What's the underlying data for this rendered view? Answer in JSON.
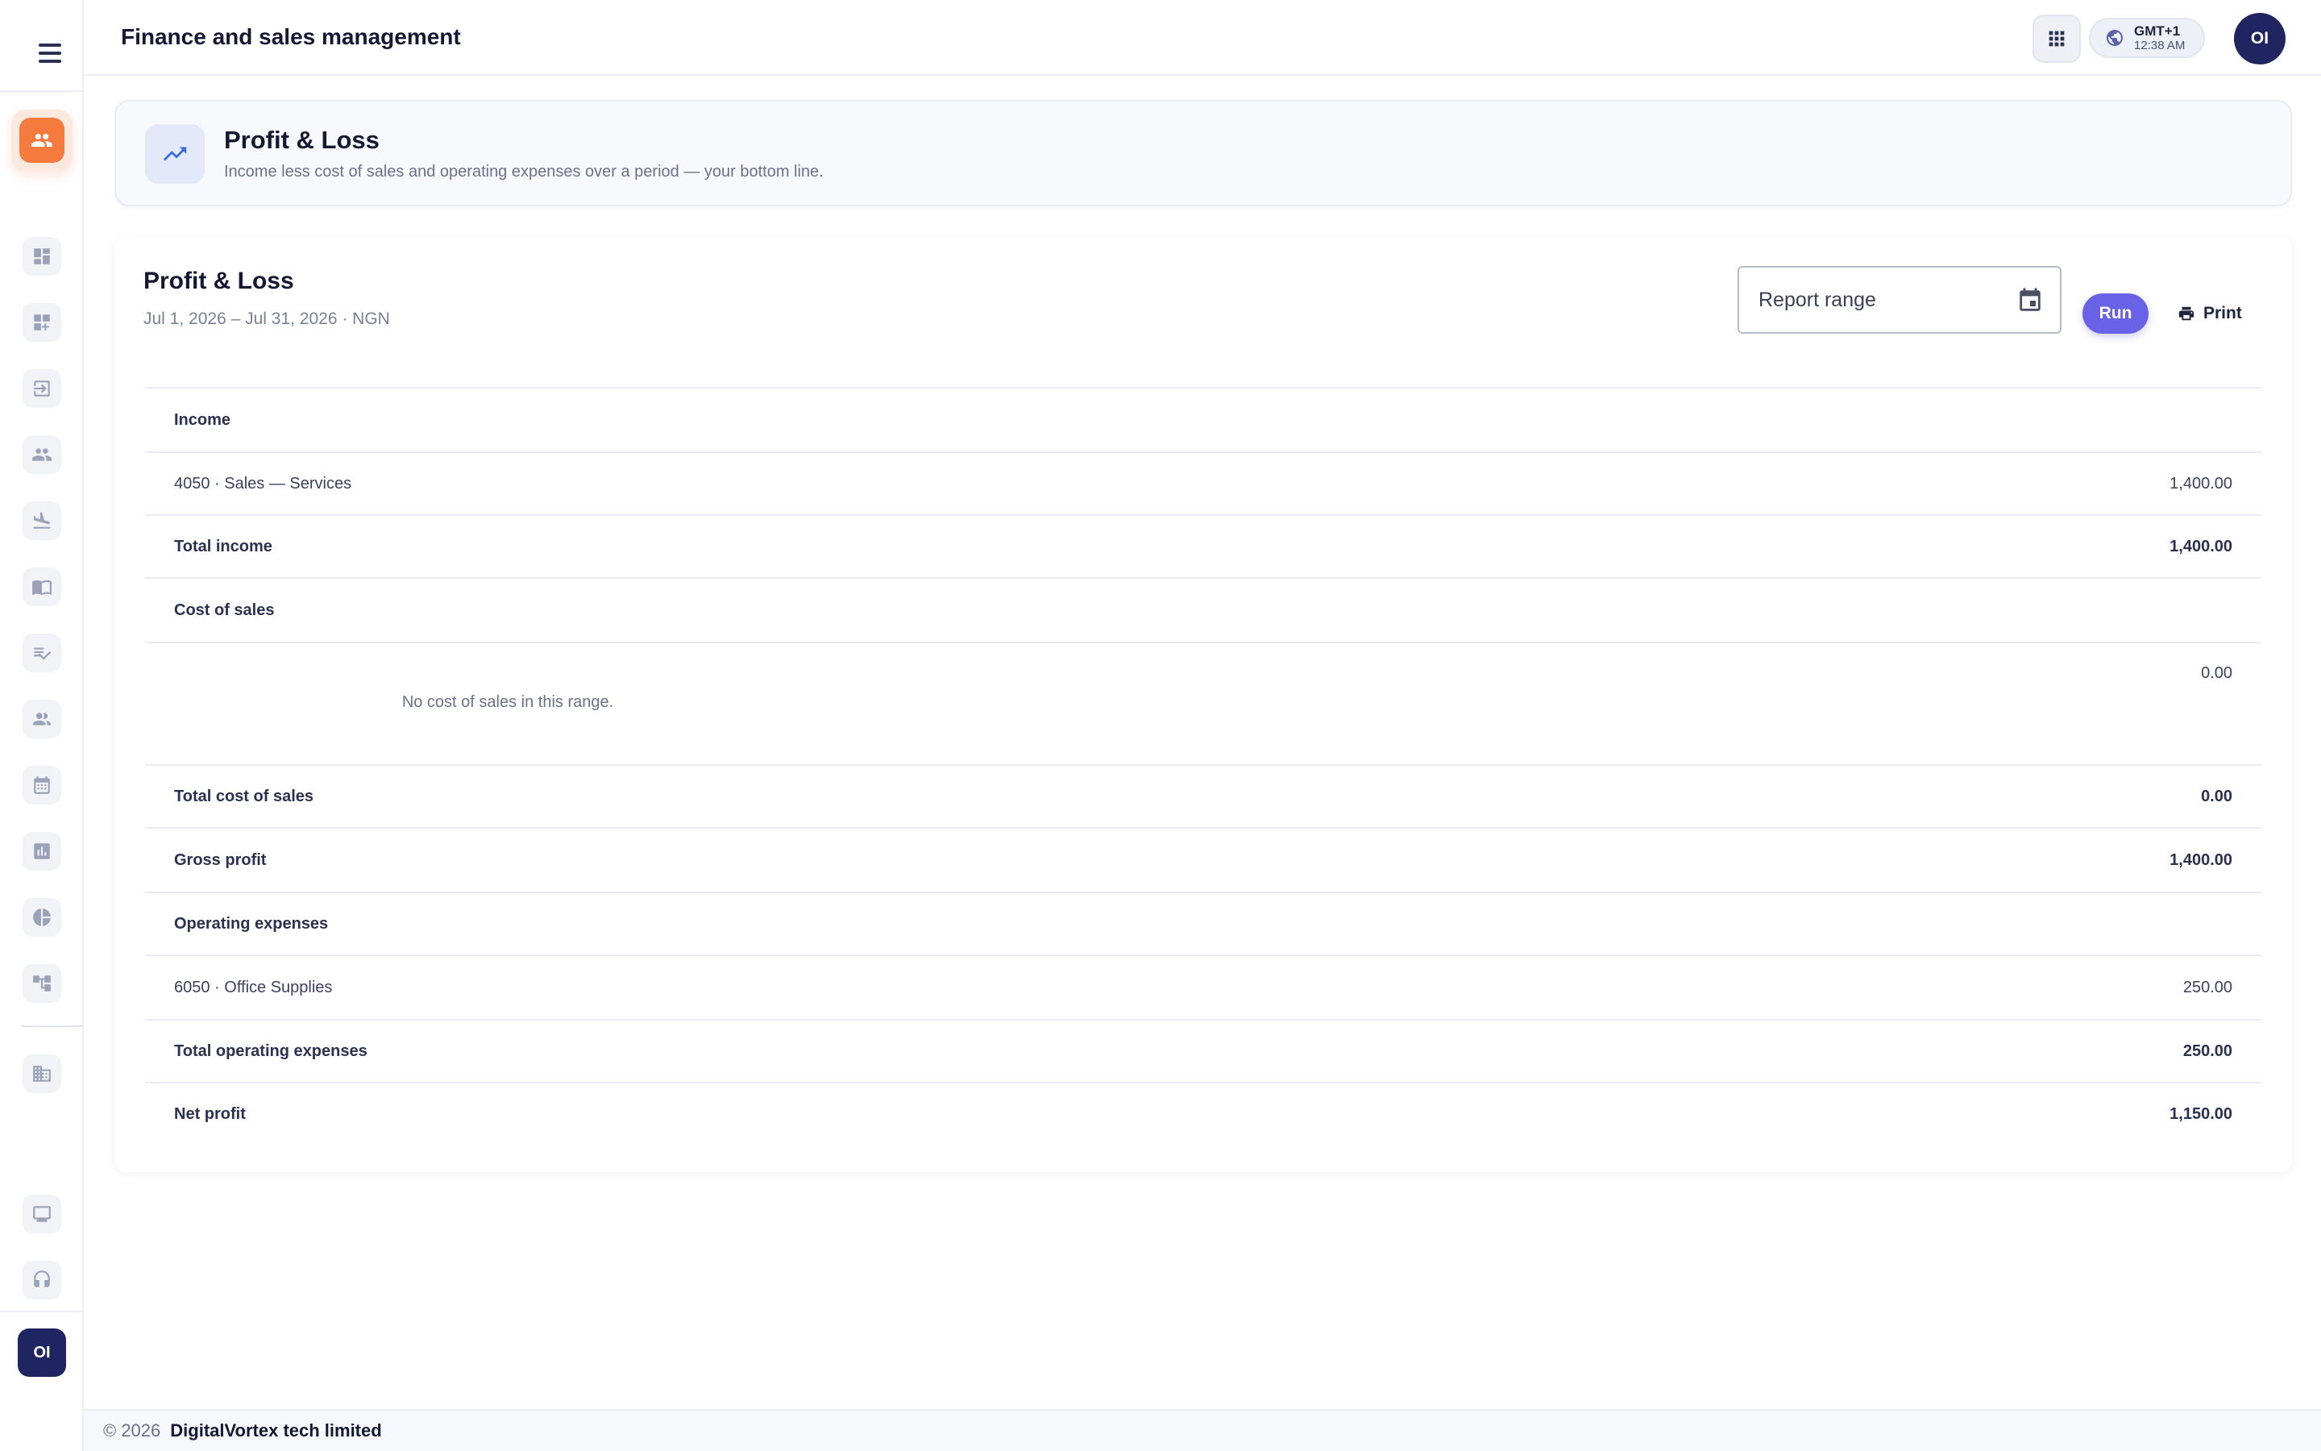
{
  "header": {
    "app_title": "Finance and sales management",
    "timezone": "GMT+1",
    "time": "12:38 AM",
    "user_initials": "OI"
  },
  "sidebar": {
    "user_initials": "OI",
    "items": [
      {
        "icon": "dashboard-icon"
      },
      {
        "icon": "dashboard-add-icon"
      },
      {
        "icon": "login-icon"
      },
      {
        "icon": "people-icon"
      },
      {
        "icon": "flight-land-icon"
      },
      {
        "icon": "menu-book-icon"
      },
      {
        "icon": "playlist-check-icon"
      },
      {
        "icon": "group-icon"
      },
      {
        "icon": "calendar-icon"
      },
      {
        "icon": "bar-chart-icon"
      },
      {
        "icon": "pie-chart-icon"
      },
      {
        "icon": "hierarchy-icon"
      },
      {
        "icon": "ledger-icon"
      },
      {
        "icon": "desktop-icon"
      },
      {
        "icon": "support-icon"
      }
    ]
  },
  "page": {
    "title": "Profit & Loss",
    "subtitle": "Income less cost of sales and operating expenses over a period — your bottom line."
  },
  "report": {
    "title": "Profit & Loss",
    "period": "Jul 1, 2026 – Jul 31, 2026 · NGN",
    "range_placeholder": "Report range",
    "run_label": "Run",
    "print_label": "Print",
    "rows": [
      {
        "label": "Income",
        "amount": "",
        "type": "section"
      },
      {
        "label": "4050 · Sales — Services",
        "amount": "1,400.00",
        "type": "line"
      },
      {
        "label": "Total income",
        "amount": "1,400.00",
        "type": "total"
      },
      {
        "label": "Cost of sales",
        "amount": "",
        "type": "section"
      },
      {
        "label": "",
        "amount": "0.00",
        "type": "empty",
        "message": "No cost of sales in this range."
      },
      {
        "label": "Total cost of sales",
        "amount": "0.00",
        "type": "total"
      },
      {
        "label": "Gross profit",
        "amount": "1,400.00",
        "type": "total"
      },
      {
        "label": "Operating expenses",
        "amount": "",
        "type": "section"
      },
      {
        "label": "6050 · Office Supplies",
        "amount": "250.00",
        "type": "line"
      },
      {
        "label": "Total operating expenses",
        "amount": "250.00",
        "type": "total"
      },
      {
        "label": "Net profit",
        "amount": "1,150.00",
        "type": "total"
      }
    ]
  },
  "footer": {
    "copyright": "© 2026",
    "company": "DigitalVortex tech limited"
  },
  "colors": {
    "accent": "#6a62e6",
    "active_nav": "#f47a3d",
    "avatar_bg": "#1f2560"
  }
}
